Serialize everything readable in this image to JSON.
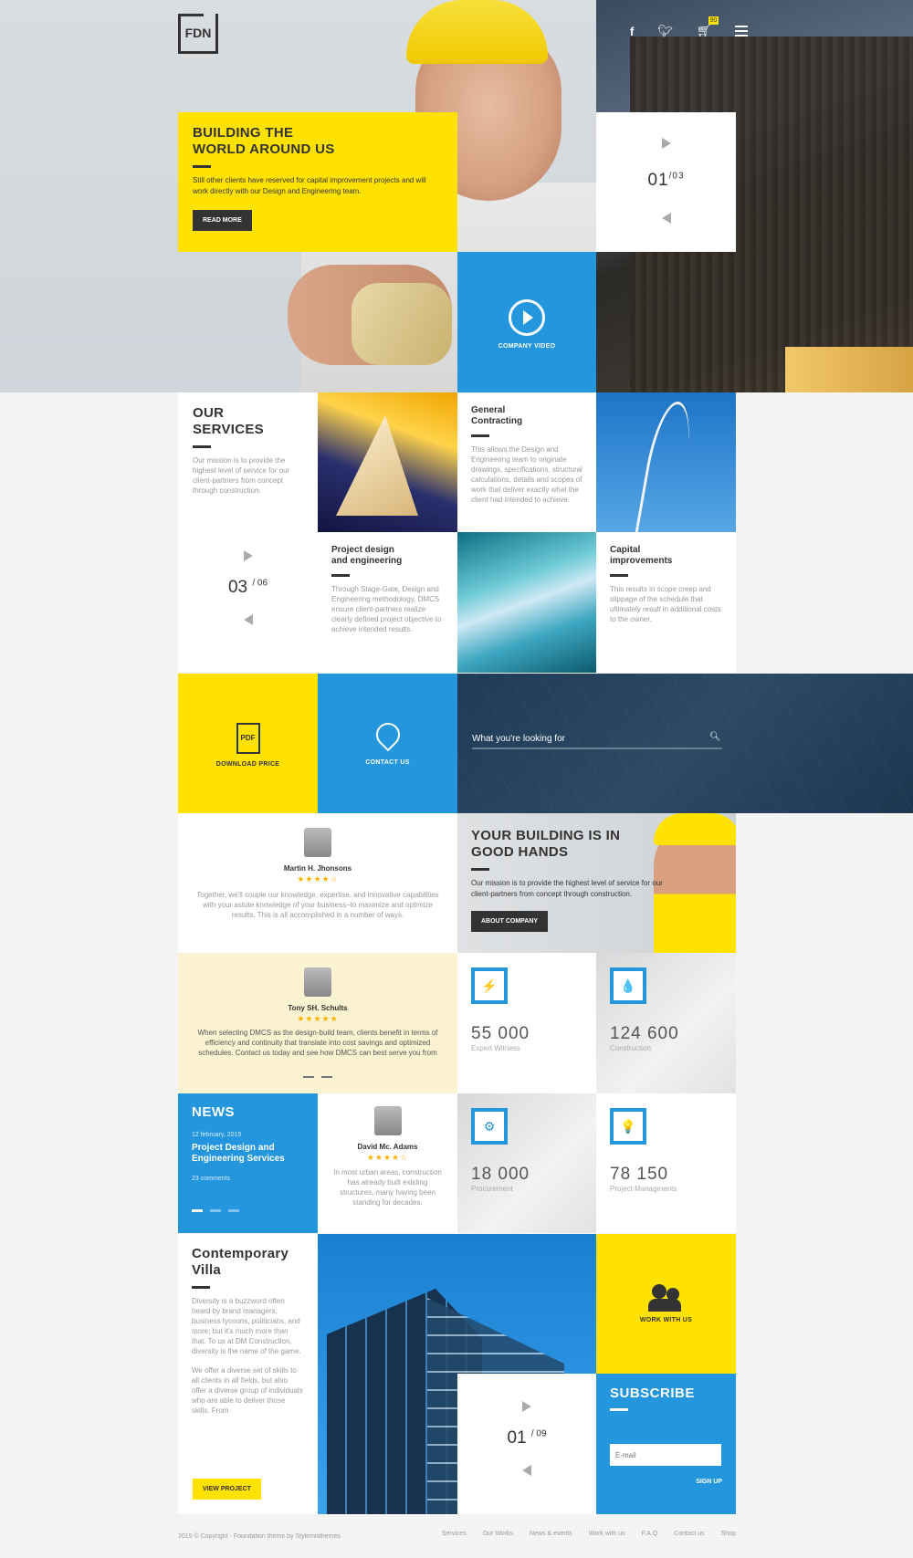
{
  "header": {
    "logo_text": "FDN",
    "cart_count": "90",
    "social": [
      "f",
      "t"
    ]
  },
  "hero": {
    "title_line1": "BUILDING THE",
    "title_line2": "WORLD AROUND US",
    "text": "Still other clients have reserved for capital improvement projects and will work directly with our Design and Engineering team.",
    "button": "READ MORE",
    "slider_current": "01",
    "slider_total": "/03",
    "video_label": "COMPANY VIDEO"
  },
  "services": {
    "title_line1": "OUR",
    "title_line2": "SERVICES",
    "text": "Our mission is to provide the highest level of service for our client-partners from concept through construction.",
    "slider_current": "03",
    "slider_total": "/ 06",
    "items": [
      {
        "title_line1": "General",
        "title_line2": "Contracting",
        "text": "This allows the Design and Engineering team to originate drawings, specifications, structural calculations, details and scopes of work that deliver exactly what the client had intended to achieve."
      },
      {
        "title_line1": "Project design",
        "title_line2": "and engineering",
        "text": "Through Stage-Gate, Design and Engineering methodology, DMCS ensure client-partners realize clearly defined project objective to achieve intended results."
      },
      {
        "title_line1": "Capital",
        "title_line2": "improvements",
        "text": "This results in scope creep and slippage of the schedule that ultimately result in additional costs to the owner."
      }
    ]
  },
  "actions": {
    "download": "DOWNLOAD PRICE",
    "pdf": "PDF",
    "contact": "CONTACT US",
    "search_placeholder": "What you're looking for"
  },
  "testimonials": [
    {
      "name": "Martin H. Jhonsons",
      "stars": "★★★★☆",
      "text": "Together, we'll couple our knowledge, expertise, and innovative capabilities with your astute knowledge of your business–to maximize and optimize results. This is all accomplished in a number of ways."
    },
    {
      "name": "Tony SH. Schults",
      "stars": "★★★★★",
      "text": "When selecting DMCS as the design-build team, clients benefit in terms of efficiency and continuity that translate into cost savings and optimized schedules. Contact us today and see how DMCS can best serve you from"
    },
    {
      "name": "David Mc. Adams",
      "stars": "★★★★☆",
      "text": "In most urban areas, construction has already built existing structures, many having been standing for decades."
    }
  ],
  "good_hands": {
    "title_line1": "YOUR BUILDING IS IN",
    "title_line2": "GOOD HANDS",
    "text": "Our mission is to provide the highest level of service for our client-partners from concept through construction.",
    "button": "ABOUT COMPANY"
  },
  "stats": [
    {
      "icon": "lightning-icon",
      "glyph": "⚡",
      "num": "55 000",
      "label": "Expert Witness"
    },
    {
      "icon": "drop-icon",
      "glyph": "💧",
      "num": "124 600",
      "label": "Construction"
    },
    {
      "icon": "gear-icon",
      "glyph": "⚙",
      "num": "18 000",
      "label": "Procurement"
    },
    {
      "icon": "bulb-icon",
      "glyph": "💡",
      "num": "78 150",
      "label": "Project Managments"
    }
  ],
  "news": {
    "title": "NEWS",
    "date": "12 february, 2015",
    "headline_line1": "Project Design and",
    "headline_line2": "Engineering Services",
    "comments": "23 comments"
  },
  "villa": {
    "title_line1": "Contemporary",
    "title_line2": "Villa",
    "text1": "Diversity is a buzzword often heard by brand managers, business tycoons, politicians, and more; but it's much more than that. To us at DM Construction, diversity is the name of the game.",
    "text2": "We offer a diverse set of skills to all clients in all fields, but also offer a diverse group of individuals who are able to deliver those skills. From",
    "button": "VIEW PROJECT",
    "slider_current": "01",
    "slider_total": "/ 09",
    "work_with_us": "WORK WITH US"
  },
  "subscribe": {
    "title": "SUBSCRIBE",
    "placeholder": "E-mail",
    "button": "SIGN UP"
  },
  "footer": {
    "copyright": "2015 © Copyright - Foundation theme by Stylemixthemes",
    "links": [
      "Services",
      "Our Works",
      "News & events",
      "Work with us",
      "F.A.Q",
      "Contact us",
      "Shop"
    ]
  },
  "colors": {
    "yellow": "#ffe200",
    "blue": "#2396de",
    "dark": "#333333",
    "navy": "#1f3b57"
  }
}
